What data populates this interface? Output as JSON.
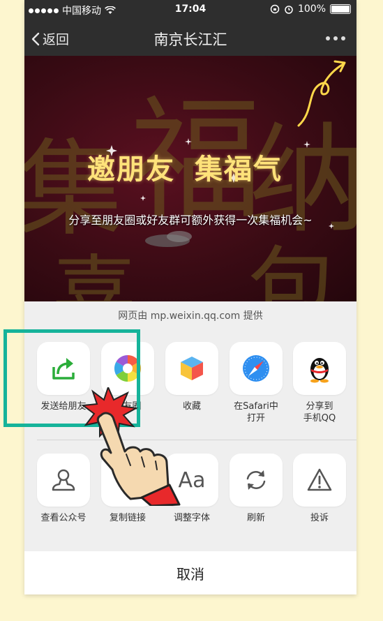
{
  "status": {
    "carrier": "中国移动",
    "time": "17:04",
    "battery": "100%"
  },
  "nav": {
    "back": "返回",
    "title": "南京长江汇"
  },
  "banner": {
    "headline_1": "邀朋友",
    "headline_2": "集福气",
    "subtitle": "分享至朋友圈或好友群可额外获得一次集福机会~"
  },
  "sheet": {
    "provider": "网页由 mp.weixin.qq.com 提供",
    "row1": [
      {
        "label": "发送给朋友",
        "icon": "share-arrow-icon"
      },
      {
        "label": "朋友圈",
        "icon": "moments-aperture-icon"
      },
      {
        "label": "收藏",
        "icon": "favorites-cube-icon"
      },
      {
        "label": "在Safari中\n打开",
        "icon": "safari-compass-icon"
      },
      {
        "label": "分享到\n手机QQ",
        "icon": "qq-penguin-icon"
      }
    ],
    "row2": [
      {
        "label": "查看公众号",
        "icon": "person-icon"
      },
      {
        "label": "复制链接",
        "icon": "link-icon"
      },
      {
        "label": "调整字体",
        "icon": "font-aa-icon",
        "glyph": "Aa"
      },
      {
        "label": "刷新",
        "icon": "refresh-icon"
      },
      {
        "label": "投诉",
        "icon": "warning-icon"
      }
    ],
    "cancel": "取消"
  },
  "colors": {
    "highlight": "#16b39a",
    "nav_bg": "#2e2e2e",
    "page_bg": "#fdf6cf"
  }
}
